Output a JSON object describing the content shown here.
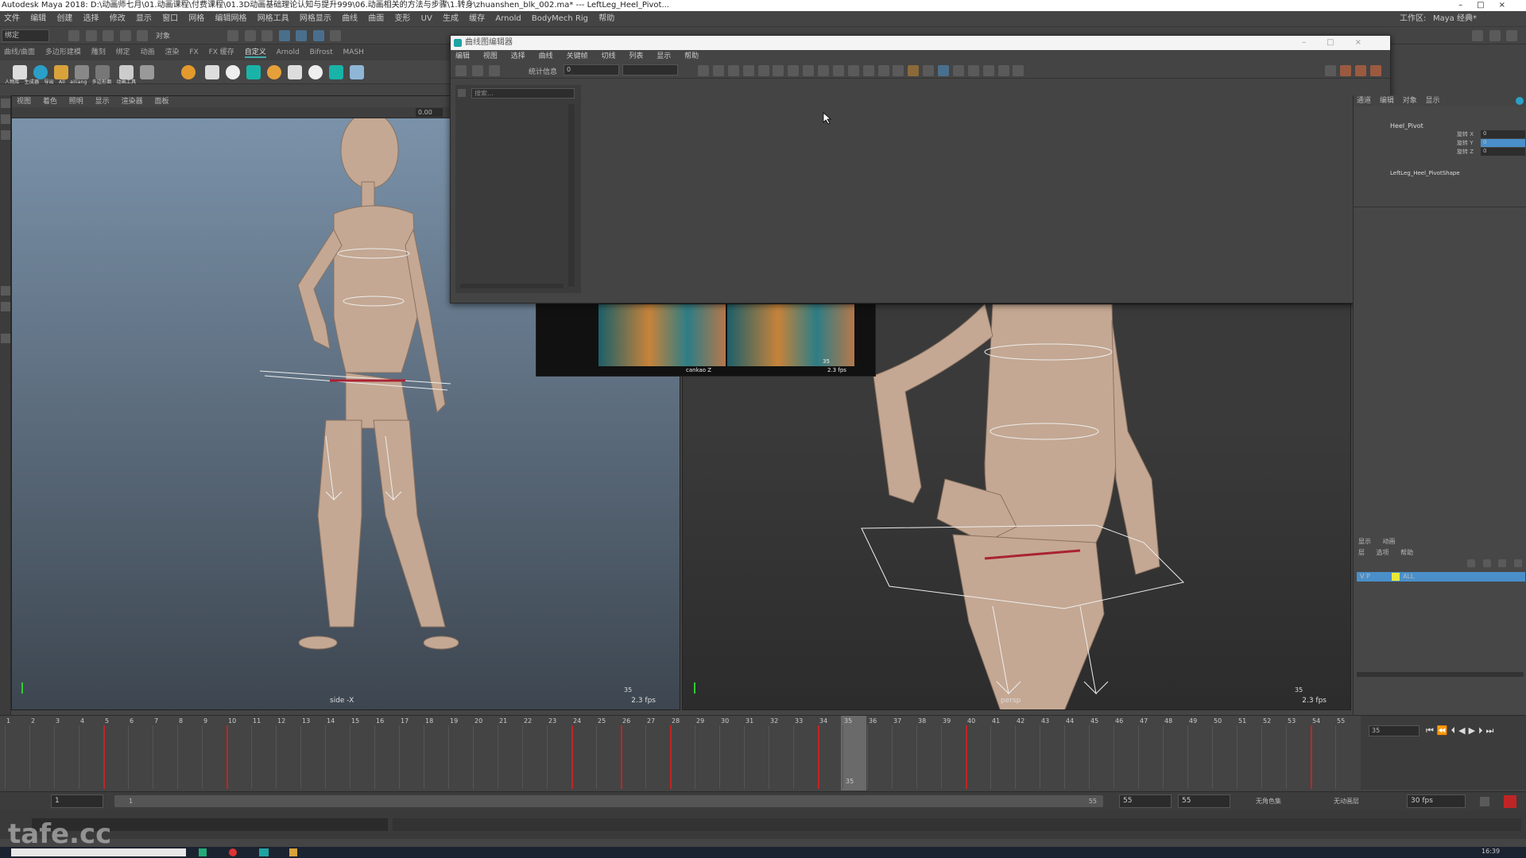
{
  "window": {
    "title": "Autodesk Maya 2018: D:\\动画师七月\\01.动画课程\\付费课程\\01.3D动画基础理论认知与提升999\\06.动画相关的方法与步骤\\1.转身\\zhuanshen_blk_002.ma*  ---  LeftLeg_Heel_Pivot..."
  },
  "menubar": {
    "items": [
      "文件",
      "编辑",
      "创建",
      "选择",
      "修改",
      "显示",
      "窗口",
      "网格",
      "编辑网格",
      "网格工具",
      "网格显示",
      "曲线",
      "曲面",
      "变形",
      "UV",
      "生成",
      "缓存",
      "Arnold",
      "BodyMech Rig",
      "帮助"
    ],
    "workspace_label": "工作区:",
    "workspace_value": "Maya 经典*"
  },
  "statusline": {
    "mode": "绑定",
    "object_field": "对象"
  },
  "shelf": {
    "tabs": [
      "曲线/曲面",
      "多边形建模",
      "雕刻",
      "绑定",
      "动画",
      "渲染",
      "FX",
      "FX 缓存",
      "自定义",
      "Arnold",
      "Bifrost",
      "MASH"
    ],
    "active_tab": "自定义",
    "labels": [
      "人物库",
      "生成器",
      "导出",
      "All",
      "ailiang",
      "多边形面",
      "动画工具"
    ]
  },
  "viewport_menu": [
    "视图",
    "着色",
    "照明",
    "显示",
    "渲染器",
    "面板"
  ],
  "viewport_left": {
    "camera": "side -X",
    "fps": "2.3 fps",
    "frame": "35",
    "field_value": "0.00"
  },
  "viewport_right": {
    "camera": "persp",
    "fps": "2.3 fps",
    "frame": "35"
  },
  "reference_panel": {
    "camera": "cankao Z",
    "fps": "2.3 fps",
    "frame": "35"
  },
  "graph_editor": {
    "title": "曲线图编辑器",
    "menu": [
      "编辑",
      "视图",
      "选择",
      "曲线",
      "关键帧",
      "切线",
      "列表",
      "显示",
      "帮助"
    ],
    "stats_label": "统计信息",
    "stats_value": "0",
    "search_placeholder": "搜索..."
  },
  "channel_box": {
    "tabs": [
      "通道",
      "编辑",
      "对象",
      "显示"
    ],
    "node_name": "Heel_Pivot",
    "shape_name": "LeftLeg_Heel_PivotShape",
    "channels": [
      {
        "label": "旋转 X",
        "value": "0"
      },
      {
        "label": "旋转 Y",
        "value": "0"
      },
      {
        "label": "旋转 Z",
        "value": "0"
      }
    ]
  },
  "layer_editor": {
    "tabs": [
      "显示",
      "动画"
    ],
    "menu": [
      "层",
      "选项",
      "帮助"
    ],
    "layer_flags": "V P",
    "layer_name": "ALL"
  },
  "timeline": {
    "current_frame": "35",
    "current_frame_field": "35",
    "ticks": [
      "1",
      "2",
      "3",
      "4",
      "5",
      "6",
      "7",
      "8",
      "9",
      "10",
      "11",
      "12",
      "13",
      "14",
      "15",
      "16",
      "17",
      "18",
      "19",
      "20",
      "21",
      "22",
      "23",
      "24",
      "25",
      "26",
      "27",
      "28",
      "29",
      "30",
      "31",
      "32",
      "33",
      "34",
      "35",
      "36",
      "37",
      "38",
      "39",
      "40",
      "41",
      "42",
      "43",
      "44",
      "45",
      "46",
      "47",
      "48",
      "49",
      "50",
      "51",
      "52",
      "53",
      "54",
      "55"
    ],
    "keyframes": [
      5,
      10,
      24,
      26,
      28,
      34,
      40,
      54
    ]
  },
  "range": {
    "start": "1",
    "inner_start": "1",
    "inner_end": "55",
    "end": "55",
    "end2": "55",
    "char_set": "无角色集",
    "anim_layer": "无动画层",
    "fps": "30 fps"
  },
  "watermark": "tafe.cc",
  "taskbar": {
    "clock": "16:39"
  },
  "colors": {
    "accent": "#1fa3a3",
    "key": "#c02525",
    "body": "#c4a893",
    "layer_highlight": "#4a8fc9"
  }
}
